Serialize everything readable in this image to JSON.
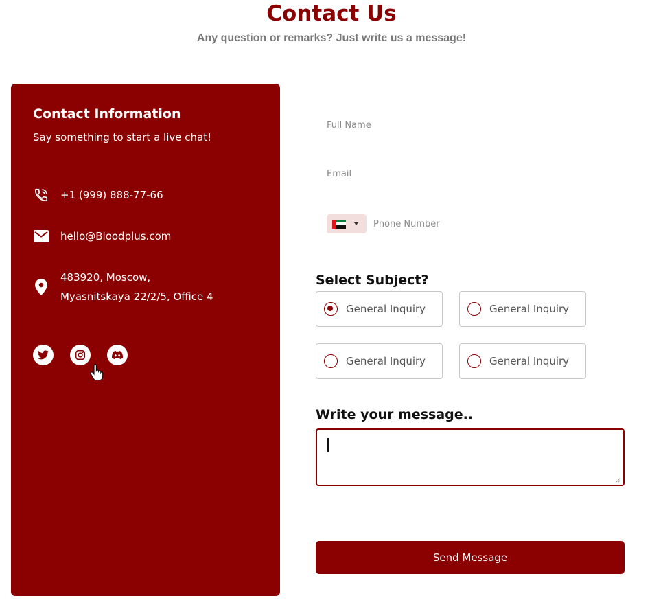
{
  "header": {
    "title": "Contact Us",
    "subtitle": "Any question or remarks? Just write us a message!"
  },
  "contact_info": {
    "title": "Contact Information",
    "subtitle": "Say something to start a live chat!",
    "phone": "+1 (999) 888-77-66",
    "email": "hello@Bloodplus.com",
    "address_line1": "483920, Moscow,",
    "address_line2": "Myasnitskaya 22/2/5, Office 4",
    "icons": {
      "phone": "phone-icon",
      "email": "mail-icon",
      "address": "location-pin-icon"
    },
    "socials": [
      "twitter-icon",
      "instagram-icon",
      "discord-icon"
    ]
  },
  "form": {
    "full_name": {
      "placeholder": "Full Name",
      "value": ""
    },
    "email": {
      "placeholder": "Email",
      "value": ""
    },
    "phone": {
      "placeholder": "Phone Number",
      "value": "",
      "country_flag": "UAE flag"
    },
    "subject_label": "Select Subject?",
    "subjects": [
      {
        "label": "General Inquiry",
        "selected": true
      },
      {
        "label": "General Inquiry",
        "selected": false
      },
      {
        "label": "General Inquiry",
        "selected": false
      },
      {
        "label": "General Inquiry",
        "selected": false
      }
    ],
    "message_label": "Write your message..",
    "message_value": "",
    "submit_label": "Send Message"
  },
  "colors": {
    "brand": "#8b0000",
    "white": "#ffffff",
    "muted_text": "#777777",
    "border": "#c8c8c8"
  }
}
